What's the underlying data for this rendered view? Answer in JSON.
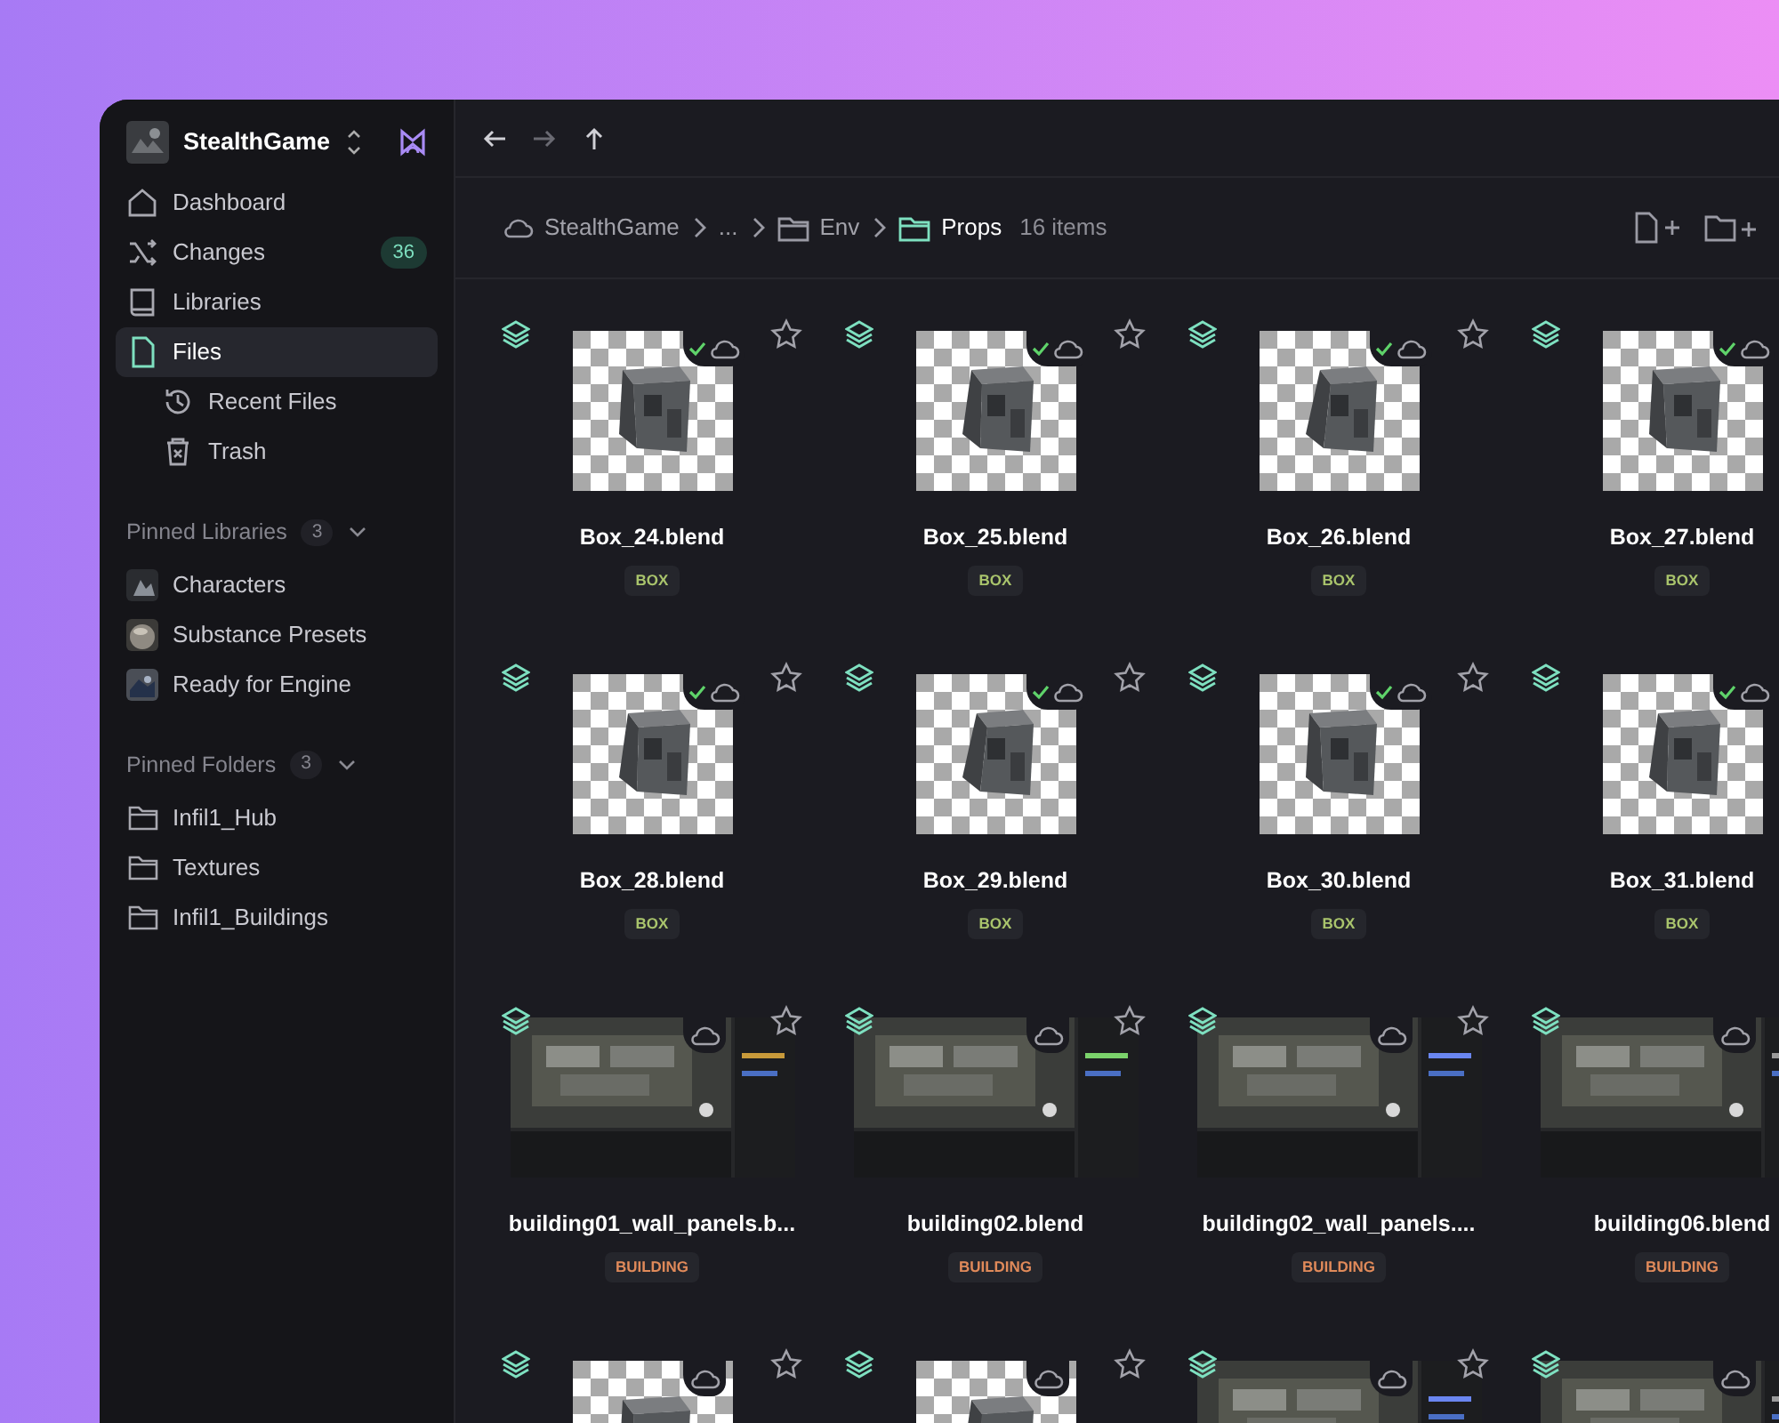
{
  "workspace": {
    "name": "StealthGame"
  },
  "nav": [
    {
      "label": "Dashboard",
      "selected": false
    },
    {
      "label": "Changes",
      "badge": "36",
      "selected": false
    },
    {
      "label": "Libraries",
      "selected": false
    },
    {
      "label": "Files",
      "selected": true,
      "children": [
        {
          "label": "Recent Files",
          "selected": false
        },
        {
          "label": "Trash",
          "selected": false
        }
      ]
    }
  ],
  "pinned_libraries": {
    "title": "Pinned Libraries",
    "count": "3",
    "expanded": true,
    "items": [
      {
        "label": "Characters",
        "kind": "picture"
      },
      {
        "label": "Substance Presets",
        "kind": "picture"
      },
      {
        "label": "Ready for Engine",
        "kind": "picture"
      }
    ]
  },
  "pinned_folders": {
    "title": "Pinned Folders",
    "count": "3",
    "expanded": true,
    "items": [
      {
        "label": "Infil1_Hub"
      },
      {
        "label": "Textures"
      },
      {
        "label": "Infil1_Buildings"
      }
    ]
  },
  "history_buttons": [
    {
      "kind": "back",
      "disabled": false
    },
    {
      "kind": "forward",
      "disabled": true
    },
    {
      "kind": "up",
      "disabled": false
    }
  ],
  "breadcrumb": [
    {
      "label": "StealthGame",
      "kind": "cloud",
      "selected": false
    },
    {
      "label": "...",
      "kind": "plain",
      "selected": false
    },
    {
      "label": "Env",
      "kind": "folder",
      "selected": false
    },
    {
      "label": "Props",
      "kind": "folder",
      "selected": true
    }
  ],
  "item_count": "16 items",
  "files": [
    {
      "name": "Box_24.blend",
      "tag": "BOX",
      "color": "#a9c46c",
      "kind": "object",
      "synced": true
    },
    {
      "name": "Box_25.blend",
      "tag": "BOX",
      "color": "#a9c46c",
      "kind": "object",
      "synced": true
    },
    {
      "name": "Box_26.blend",
      "tag": "BOX",
      "color": "#a9c46c",
      "kind": "object",
      "synced": true
    },
    {
      "name": "Box_27.blend",
      "tag": "BOX",
      "color": "#a9c46c",
      "kind": "object",
      "synced": true
    },
    {
      "name": "Box_28.blend",
      "tag": "BOX",
      "color": "#a9c46c",
      "kind": "object",
      "synced": true
    },
    {
      "name": "Box_29.blend",
      "tag": "BOX",
      "color": "#a9c46c",
      "kind": "object",
      "synced": true
    },
    {
      "name": "Box_30.blend",
      "tag": "BOX",
      "color": "#a9c46c",
      "kind": "object",
      "synced": true
    },
    {
      "name": "Box_31.blend",
      "tag": "BOX",
      "color": "#a9c46c",
      "kind": "object",
      "synced": true
    },
    {
      "name": "building01_wall_panels.b...",
      "tag": "BUILDING",
      "color": "#e08a5a",
      "kind": "scene",
      "synced": false
    },
    {
      "name": "building02.blend",
      "tag": "BUILDING",
      "color": "#e08a5a",
      "kind": "scene",
      "synced": false
    },
    {
      "name": "building02_wall_panels....",
      "tag": "BUILDING",
      "color": "#e08a5a",
      "kind": "scene",
      "synced": false
    },
    {
      "name": "building06.blend",
      "tag": "BUILDING",
      "color": "#e08a5a",
      "kind": "scene",
      "synced": false
    },
    {
      "kind": "object",
      "synced": false
    },
    {
      "kind": "object",
      "synced": false
    },
    {
      "kind": "scene",
      "synced": false
    },
    {
      "kind": "scene",
      "synced": false
    }
  ]
}
